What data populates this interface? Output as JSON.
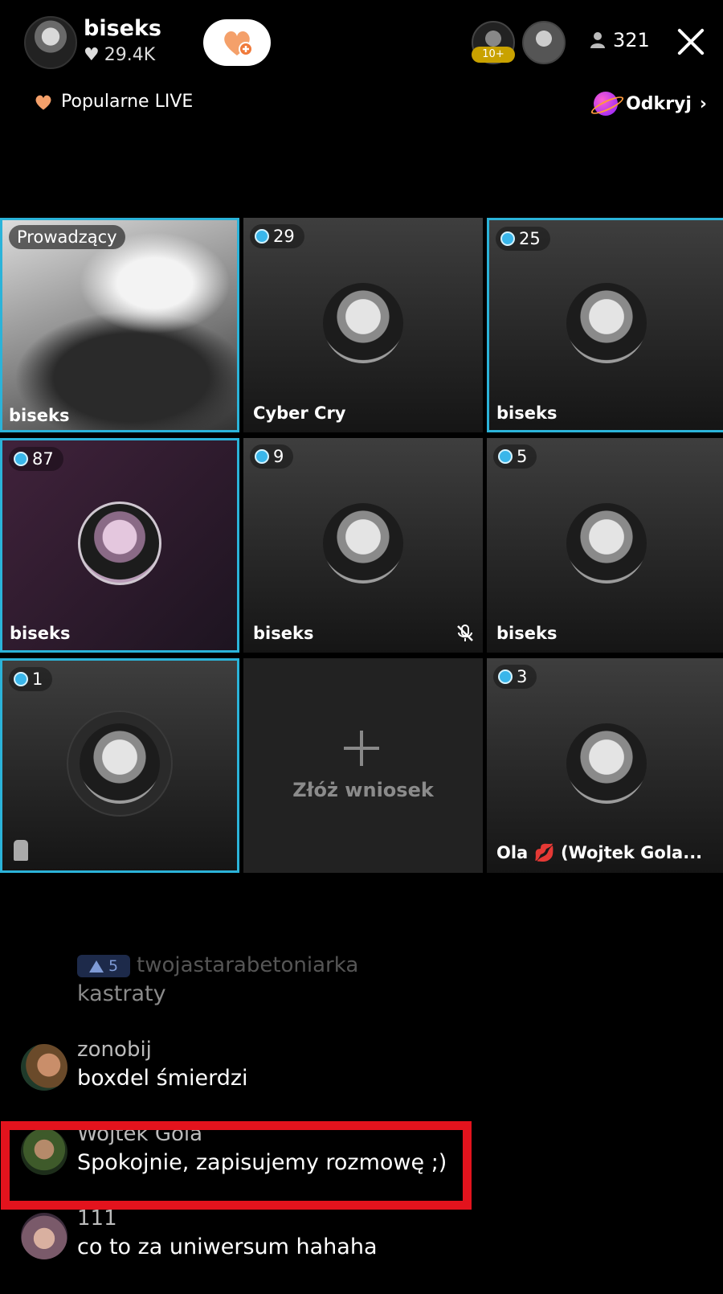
{
  "header": {
    "host_name": "biseks",
    "host_likes": "29.4K",
    "viewer_badge": "10+",
    "viewer_count": "321",
    "popular_label": "Popularne LIVE",
    "discover_label": "Odkryj"
  },
  "grid": {
    "host_badge": "Prowadzący",
    "host_name": "biseks",
    "tiles": [
      {
        "badge": "29",
        "name": "Cyber Cry"
      },
      {
        "badge": "25",
        "name": "biseks"
      },
      {
        "badge": "87",
        "name": "biseks"
      },
      {
        "badge": "9",
        "name": "biseks"
      },
      {
        "badge": "5",
        "name": "biseks"
      },
      {
        "badge": "1",
        "name": ""
      },
      {
        "badge": "3",
        "name": "Ola 💋 (Wojtek Gola..."
      }
    ],
    "apply_label": "Złóż wniosek"
  },
  "chat": {
    "messages": [
      {
        "level": "5",
        "user": "twojastarabetoniarka",
        "text": "kastraty"
      },
      {
        "user": "zonobij",
        "text": "boxdel śmierdzi"
      },
      {
        "user": "Wojtek Gola",
        "text": "Spokojnie, zapisujemy rozmowę ;)"
      },
      {
        "user": "111",
        "text": "co to za uniwersum hahaha"
      }
    ]
  },
  "colors": {
    "highlight_border": "#2bb3d9",
    "annotation_red": "#e3131d",
    "follow_heart": "#f4a06a"
  }
}
